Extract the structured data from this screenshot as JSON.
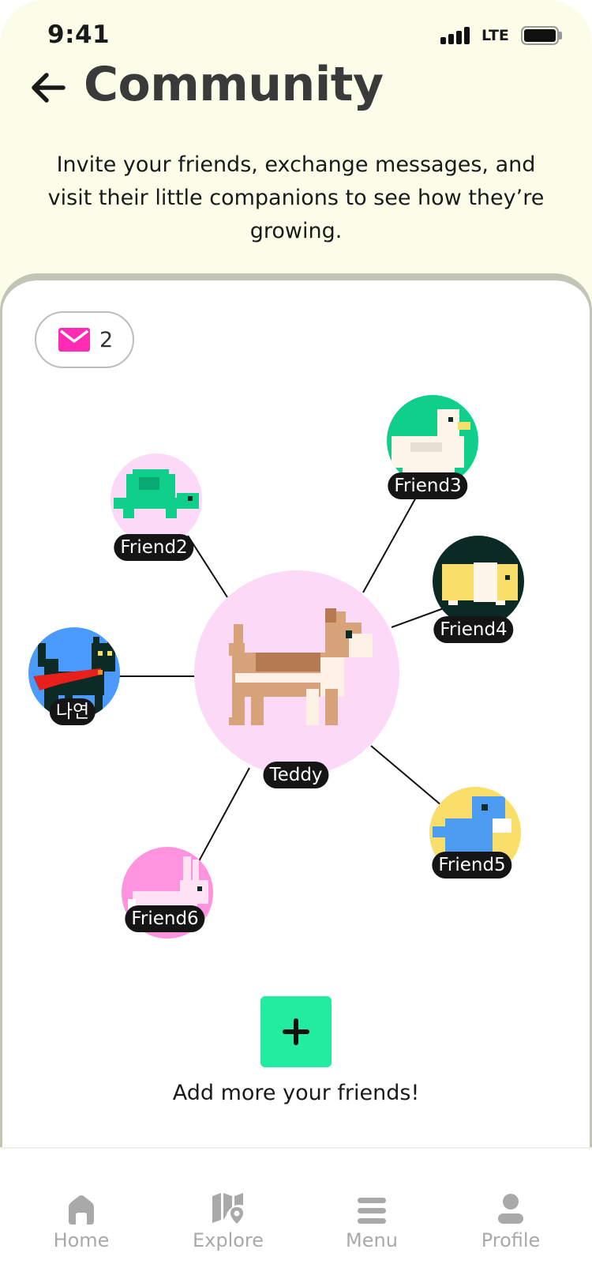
{
  "status_bar": {
    "time": "9:41",
    "network": "LTE"
  },
  "header": {
    "title": "Community",
    "description": "Invite your friends, exchange messages, and visit their little companions to see how they’re growing."
  },
  "messages": {
    "icon": "mail-icon",
    "count": "2"
  },
  "center_pet": {
    "name": "Teddy",
    "icon": "dog-icon"
  },
  "friends": [
    {
      "name": "Friend2",
      "icon": "turtle-icon",
      "color": "#fcd9f6"
    },
    {
      "name": "Friend3",
      "icon": "duck-icon",
      "color": "#0fcf8b"
    },
    {
      "name": "Friend4",
      "icon": "guinea-pig-icon",
      "color": "#0b2a26"
    },
    {
      "name": "나연",
      "icon": "black-cat-icon",
      "color": "#4b9bff"
    },
    {
      "name": "Friend5",
      "icon": "dinosaur-icon",
      "color": "#f9de6a"
    },
    {
      "name": "Friend6",
      "icon": "rabbit-icon",
      "color": "#ff93dd"
    }
  ],
  "add_friends": {
    "caption": "Add more your friends!",
    "icon": "plus-icon"
  },
  "tabbar": {
    "home": "Home",
    "explore": "Explore",
    "menu": "Menu",
    "profile": "Profile"
  },
  "colors": {
    "accent": "#22ec9f",
    "mail": "#ff2bb5",
    "header_bg": "#fbfde9"
  }
}
